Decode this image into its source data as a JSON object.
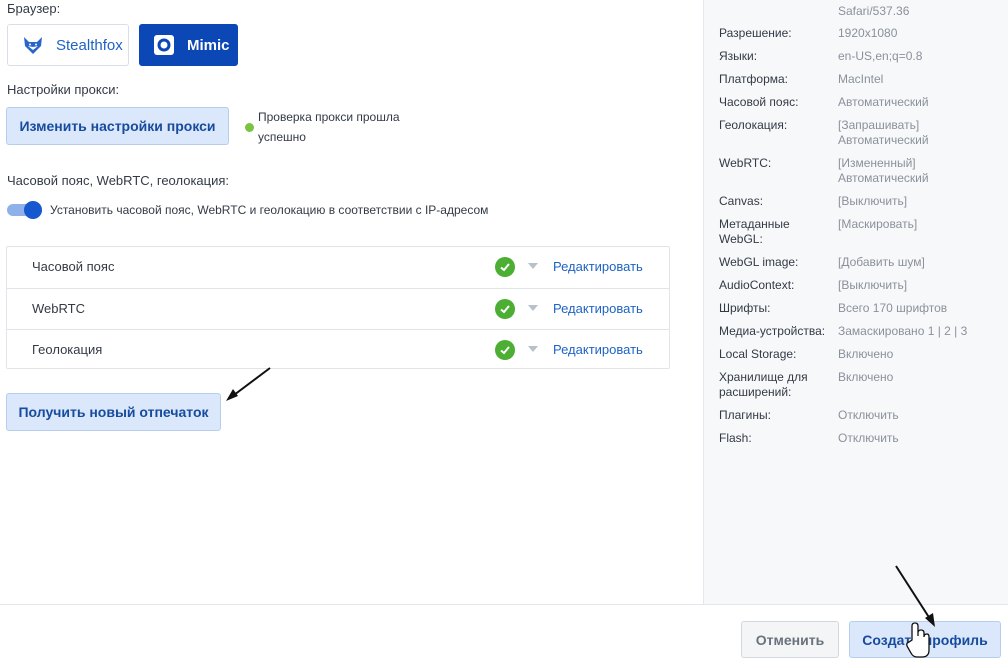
{
  "browser": {
    "label": "Браузер:",
    "options": [
      {
        "name": "Stealthfox",
        "selected": false
      },
      {
        "name": "Mimic",
        "selected": true
      }
    ]
  },
  "proxy": {
    "label": "Настройки прокси:",
    "button": "Изменить настройки прокси",
    "status_line1": "Проверка прокси прошла",
    "status_line2": "успешно",
    "status_color": "#79c341"
  },
  "geo": {
    "label": "Часовой пояс, WebRTC, геолокация:",
    "toggle_on": true,
    "toggle_text": "Установить часовой пояс, WebRTC и геолокацию в соответствии с IP-адресом",
    "rows": [
      {
        "label": "Часовой пояс",
        "edit": "Редактировать"
      },
      {
        "label": "WebRTC",
        "edit": "Редактировать"
      },
      {
        "label": "Геолокация",
        "edit": "Редактировать"
      }
    ]
  },
  "fingerprint_button": "Получить новый отпечаток",
  "summary": [
    {
      "key": "",
      "value": "Safari/537.36"
    },
    {
      "key": "Разрешение:",
      "value": "1920x1080"
    },
    {
      "key": "Языки:",
      "value": "en-US,en;q=0.8"
    },
    {
      "key": "Платформа:",
      "value": "MacIntel"
    },
    {
      "key": "Часовой пояс:",
      "value": "Автоматический"
    },
    {
      "key": "Геолокация:",
      "value": "[Запрашивать]\nАвтоматический"
    },
    {
      "key": "WebRTC:",
      "value": "[Измененный]\nАвтоматический"
    },
    {
      "key": "Canvas:",
      "value": "[Выключить]"
    },
    {
      "key": "Метаданные\nWebGL:",
      "value": "[Маскировать]"
    },
    {
      "key": "WebGL image:",
      "value": "[Добавить шум]"
    },
    {
      "key": "AudioContext:",
      "value": "[Выключить]"
    },
    {
      "key": "Шрифты:",
      "value": "Всего 170 шрифтов"
    },
    {
      "key": "Медиа-устройства:",
      "value": "Замаскировано 1 | 2 | 3"
    },
    {
      "key": "Local Storage:",
      "value": "Включено"
    },
    {
      "key": "Хранилище для\nрасширений:",
      "value": "Включено"
    },
    {
      "key": "Плагины:",
      "value": "Отключить"
    },
    {
      "key": "Flash:",
      "value": "Отключить"
    }
  ],
  "footer": {
    "cancel": "Отменить",
    "create": "Создать профиль"
  },
  "colors": {
    "accent": "#0b47b5",
    "link": "#1e63c4",
    "success": "#4cae33"
  }
}
